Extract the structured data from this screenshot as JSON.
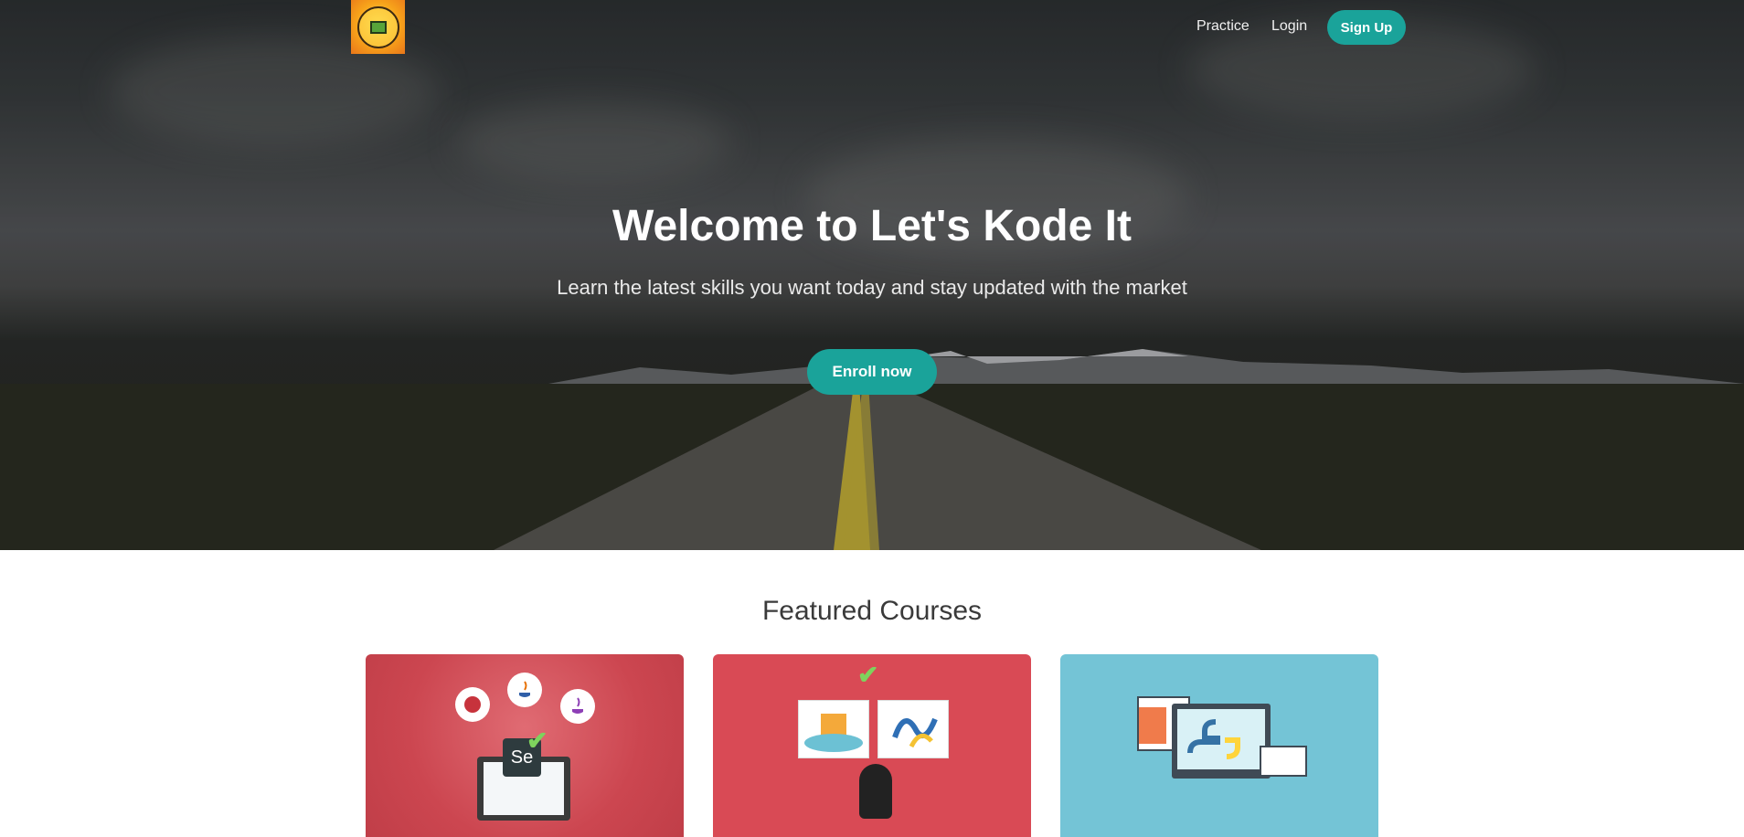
{
  "nav": {
    "logo_alt": "Let's Kode It",
    "practice": "Practice",
    "login": "Login",
    "signup": "Sign Up"
  },
  "hero": {
    "title": "Welcome to Let's Kode It",
    "subtitle": "Learn the latest skills you want today and stay updated with the market",
    "cta": "Enroll now"
  },
  "featured": {
    "title": "Featured Courses",
    "cards": [
      {
        "icon": "selenium-java-course-image"
      },
      {
        "icon": "web-services-course-image"
      },
      {
        "icon": "python-course-image"
      }
    ]
  },
  "colors": {
    "accent": "#1aa39a",
    "card1": "#cc4650",
    "card2": "#d94a55",
    "card3": "#74c4d6"
  },
  "card_text": {
    "se": "Se"
  }
}
